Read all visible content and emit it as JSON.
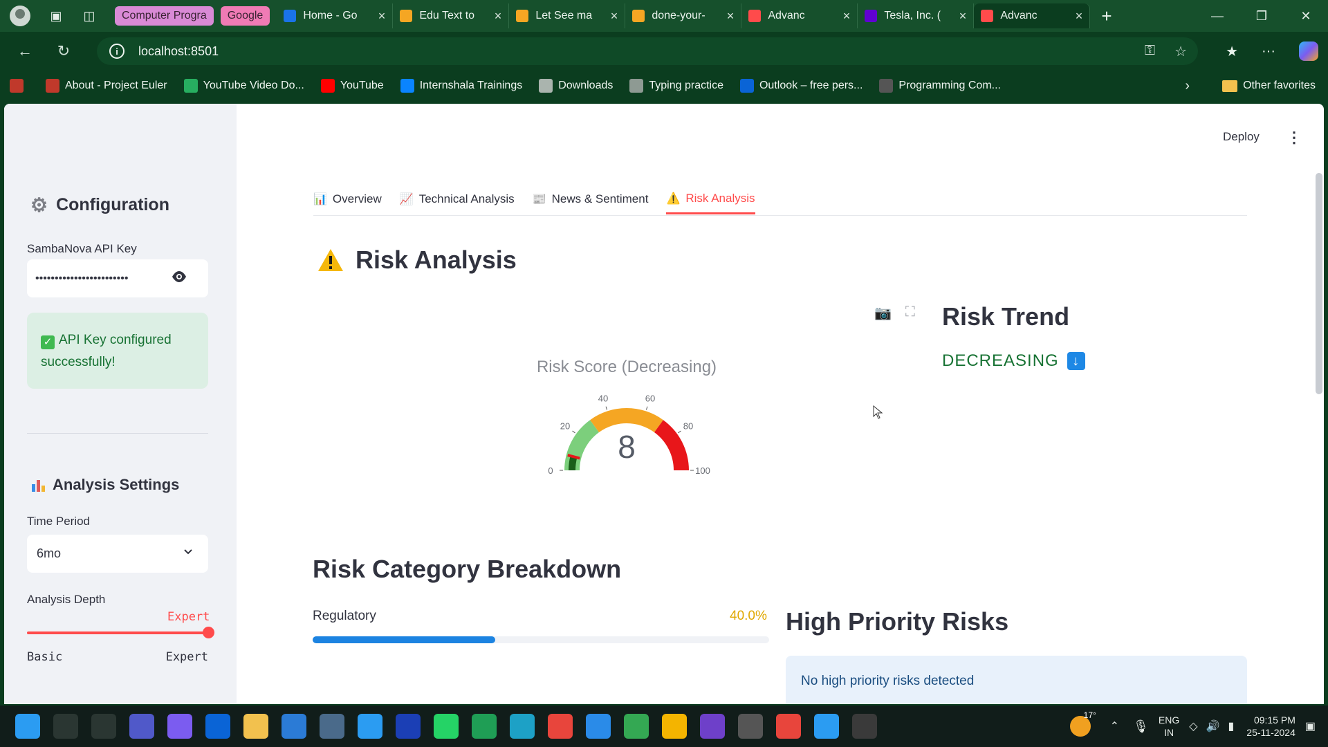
{
  "browser": {
    "tab_groups": [
      {
        "label": "Computer Progra",
        "color": "#d98ad6"
      },
      {
        "label": "Google",
        "color": "#f07bb5"
      }
    ],
    "tabs": [
      {
        "title": "Home - Go",
        "icon": "drive-icon",
        "color": "#1a73e8"
      },
      {
        "title": "Edu Text to",
        "icon": "colab-icon",
        "color": "#f5a623"
      },
      {
        "title": "Let See ma",
        "icon": "colab-icon",
        "color": "#f5a623"
      },
      {
        "title": "done-your-",
        "icon": "colab-icon",
        "color": "#f5a623"
      },
      {
        "title": "Advanc",
        "icon": "streamlit-icon",
        "color": "#ff4b4b"
      },
      {
        "title": "Tesla, Inc. (",
        "icon": "yahoo-icon",
        "color": "#6001d2"
      },
      {
        "title": "Advanc",
        "icon": "streamlit-icon",
        "color": "#ff4b4b",
        "active": true
      }
    ],
    "url": "localhost:8501",
    "bookmarks": [
      {
        "label": "About - Project Euler",
        "color": "#c0392b"
      },
      {
        "label": "YouTube Video Do...",
        "color": "#27ae60"
      },
      {
        "label": "YouTube",
        "color": "#ff0000"
      },
      {
        "label": "Internshala Trainings",
        "color": "#0a84ff"
      },
      {
        "label": "Downloads",
        "color": "#aab4ae"
      },
      {
        "label": "Typing practice",
        "color": "#8e9a93"
      },
      {
        "label": "Outlook – free pers...",
        "color": "#0a64d6"
      },
      {
        "label": "Programming Com...",
        "color": "#555"
      }
    ],
    "other_favorites": "Other favorites"
  },
  "sidebar": {
    "config_title": "Configuration",
    "api_key_label": "SambaNova API Key",
    "api_key_value": "••••••••••••••••••••••••",
    "success_text": "API Key configured successfully!",
    "analysis_title": "Analysis Settings",
    "time_period_label": "Time Period",
    "time_period_value": "6mo",
    "depth_label": "Analysis Depth",
    "depth_value": "Expert",
    "depth_min": "Basic",
    "depth_max": "Expert"
  },
  "header": {
    "deploy_label": "Deploy"
  },
  "main": {
    "tabs": [
      {
        "label": "Overview",
        "icon": "📊"
      },
      {
        "label": "Technical Analysis",
        "icon": "📈"
      },
      {
        "label": "News & Sentiment",
        "icon": "📰"
      },
      {
        "label": "Risk Analysis",
        "icon": "⚠️",
        "active": true
      }
    ],
    "title": "Risk Analysis",
    "trend_title": "Risk Trend",
    "trend_value": "DECREASING",
    "breakdown_title": "Risk Category Breakdown",
    "categories": [
      {
        "label": "Regulatory",
        "percent_text": "40.0%",
        "fraction": 0.4
      }
    ],
    "high_priority_title": "High Priority Risks",
    "high_priority_message": "No high priority risks detected"
  },
  "chart_data": {
    "type": "gauge",
    "title": "Risk Score (Decreasing)",
    "value": 8,
    "range": [
      0,
      100
    ],
    "ticks": [
      0,
      20,
      40,
      60,
      80,
      100
    ],
    "bands": [
      {
        "from": 0,
        "to": 30,
        "color": "#7ccf7c"
      },
      {
        "from": 30,
        "to": 70,
        "color": "#f5a623"
      },
      {
        "from": 70,
        "to": 100,
        "color": "#e8161a"
      }
    ],
    "bar_color": "#1a5e1a",
    "threshold": {
      "value": 8,
      "color": "#e8161a"
    }
  },
  "taskbar": {
    "apps": [
      {
        "name": "windows-start-icon",
        "color": "#2b9cf2"
      },
      {
        "name": "search-icon",
        "color": "#2a3632"
      },
      {
        "name": "task-view-icon",
        "color": "#2a3632"
      },
      {
        "name": "teams-icon",
        "color": "#5059c9"
      },
      {
        "name": "copilot-icon",
        "color": "#7b5cf0"
      },
      {
        "name": "outlook-icon",
        "color": "#0a64d6"
      },
      {
        "name": "file-explorer-icon",
        "color": "#f2c14e"
      },
      {
        "name": "remote-desktop-icon",
        "color": "#2b7bd6"
      },
      {
        "name": "calculator-icon",
        "color": "#4a6a8a"
      },
      {
        "name": "store-icon",
        "color": "#2b9cf2"
      },
      {
        "name": "l-app-icon",
        "color": "#1b3fb5"
      },
      {
        "name": "whatsapp-icon",
        "color": "#25d366"
      },
      {
        "name": "whatsapp-business-icon",
        "color": "#1f9e55"
      },
      {
        "name": "edge-icon",
        "color": "#1da1c6"
      },
      {
        "name": "chrome-icon",
        "color": "#e8453c"
      },
      {
        "name": "vscode-icon",
        "color": "#2a8be8"
      },
      {
        "name": "chrome-icon",
        "color": "#34a853"
      },
      {
        "name": "chrome-icon",
        "color": "#f4b400"
      },
      {
        "name": "github-icon",
        "color": "#6e40c9"
      },
      {
        "name": "snipping-tool-icon",
        "color": "#555"
      },
      {
        "name": "chrome-icon",
        "color": "#e8453c"
      },
      {
        "name": "photos-icon",
        "color": "#2b9cf2"
      },
      {
        "name": "obs-icon",
        "color": "#3a3a3a"
      }
    ],
    "temperature": "17°",
    "lang": "ENG",
    "region": "IN",
    "time": "09:15 PM",
    "date": "25-11-2024"
  }
}
